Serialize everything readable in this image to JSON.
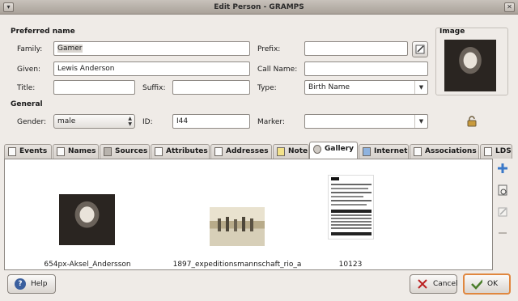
{
  "window": {
    "title": "Edit Person - GRAMPS",
    "close_glyph": "✕"
  },
  "form": {
    "preferred_name_heading": "Preferred name",
    "general_heading": "General",
    "family_label": "Family:",
    "family_value": "Gamer",
    "given_label": "Given:",
    "given_value": "Lewis Anderson",
    "title_label": "Title:",
    "title_value": "",
    "suffix_label": "Suffix:",
    "suffix_value": "",
    "prefix_label": "Prefix:",
    "prefix_value": "",
    "callname_label": "Call Name:",
    "callname_value": "",
    "type_label": "Type:",
    "type_value": "Birth Name",
    "gender_label": "Gender:",
    "gender_value": "male",
    "id_label": "ID:",
    "id_value": "I44",
    "marker_label": "Marker:",
    "marker_value": "",
    "image_label": "Image"
  },
  "tabs": [
    {
      "label": "Events"
    },
    {
      "label": "Names"
    },
    {
      "label": "Sources"
    },
    {
      "label": "Attributes"
    },
    {
      "label": "Addresses"
    },
    {
      "label": "Note"
    },
    {
      "label": "Gallery"
    },
    {
      "label": "Internet"
    },
    {
      "label": "Associations"
    },
    {
      "label": "LDS"
    }
  ],
  "active_tab": "Gallery",
  "gallery": [
    {
      "caption": "654px-Aksel_Andersson"
    },
    {
      "caption": "1897_expeditionsmannschaft_rio_a"
    },
    {
      "caption": "10123"
    }
  ],
  "buttons": {
    "help": "Help",
    "cancel": "Cancel",
    "ok": "OK"
  },
  "colors": {
    "focus_border": "#e0873f",
    "add_icon": "#3a78c8"
  }
}
